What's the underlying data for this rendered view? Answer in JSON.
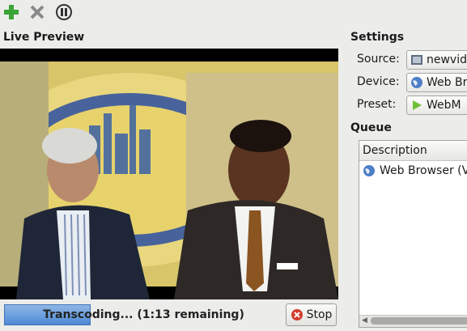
{
  "toolbar": {
    "add_icon": "plus-icon",
    "remove_icon": "close-icon",
    "pause_icon": "pause-icon",
    "colors": {
      "add": "#3aa537",
      "remove": "#8a8a8a"
    }
  },
  "preview": {
    "title": "Live Preview",
    "video_description": "Two men seated for an interview in front of a yellow backdrop"
  },
  "progress": {
    "text": "Transcoding... (1:13 remaining)",
    "fraction": 0.31
  },
  "stop_button": {
    "label": "Stop",
    "icon": "stop-icon"
  },
  "settings": {
    "title": "Settings",
    "rows": [
      {
        "label": "Source:",
        "value": "newvid",
        "icon": "film-icon"
      },
      {
        "label": "Device:",
        "value": "Web Br",
        "icon": "globe-icon"
      },
      {
        "label": "Preset:",
        "value": "WebM",
        "icon": "webm-icon"
      }
    ]
  },
  "queue": {
    "title": "Queue",
    "column_header": "Description",
    "items": [
      {
        "label": "Web Browser (V",
        "icon": "globe-icon"
      }
    ]
  }
}
